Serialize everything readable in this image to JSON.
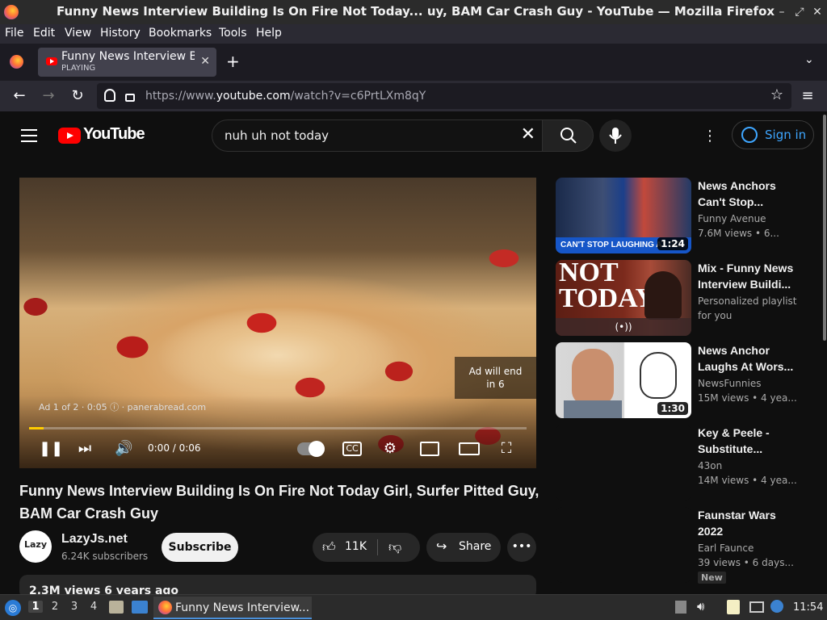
{
  "window": {
    "title": "Funny News Interview Building Is On Fire Not Today...  uy, BAM Car Crash Guy - YouTube — Mozilla Firefox"
  },
  "menu": [
    "File",
    "Edit",
    "View",
    "History",
    "Bookmarks",
    "Tools",
    "Help"
  ],
  "tab": {
    "title": "Funny News Interview Bu",
    "status": "PLAYING"
  },
  "urlbar": {
    "prefix": "https://www.",
    "domain": "youtube.com",
    "path": "/watch?v=c6PrtLXm8qY"
  },
  "youtube": {
    "logo_text": "YouTube",
    "search_query": "nuh uh not today",
    "sign_in": "Sign in"
  },
  "player": {
    "ad_info": "Ad 1 of 2 · 0:05 ⓘ · panerabread.com",
    "ad_end_line1": "Ad will end",
    "ad_end_line2": "in 6",
    "time": "0:00 / 0:06",
    "progress_fraction": 0.03
  },
  "video": {
    "title": "Funny News Interview Building Is On Fire Not Today Girl, Surfer Pitted Guy, BAM Car Crash Guy",
    "channel": "LazyJs.net",
    "channel_avatar_text": "Lazy",
    "subscribers": "6.24K subscribers",
    "subscribe": "Subscribe",
    "likes": "11K",
    "share": "Share",
    "views": "2.3M views  6 years ago"
  },
  "recommendations": [
    {
      "title": "News Anchors Can't Stop...",
      "channel": "Funny Avenue",
      "meta": "7.6M views  • 6...",
      "duration": "1:24",
      "thumb_caption": "CAN'T STOP LAUGHING AT GO/"
    },
    {
      "title": "Mix - Funny News Interview Buildi...",
      "channel": "Personalized playlist",
      "meta": "for you",
      "duration": "",
      "thumb_caption": "NOT TODAY"
    },
    {
      "title": "News Anchor Laughs At Wors...",
      "channel": "NewsFunnies",
      "meta": "15M views  • 4 yea...",
      "duration": "1:30",
      "thumb_caption": ""
    },
    {
      "title": "Key & Peele - Substitute...",
      "channel": "43on",
      "meta": "14M views  • 4 yea...",
      "duration": "",
      "thumb_caption": ""
    },
    {
      "title": "Faunstar Wars 2022",
      "channel": "Earl Faunce",
      "meta": "39 views  • 6 days...",
      "duration": "",
      "thumb_caption": "",
      "badge": "New"
    }
  ],
  "taskbar": {
    "workspaces": [
      "1",
      "2",
      "3",
      "4"
    ],
    "app_label": "Funny News Interview...",
    "clock": "11:54"
  },
  "colors": {
    "youtube_red": "#ff0000",
    "signin_blue": "#3ea6ff",
    "ad_progress": "#ffcc00"
  }
}
